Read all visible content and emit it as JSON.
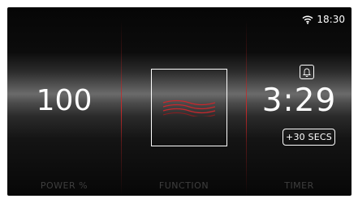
{
  "status_bar": {
    "wifi_icon": "wifi-icon",
    "time": "18:30"
  },
  "power": {
    "value": "100",
    "label": "POWER %"
  },
  "function": {
    "icon": "grill-waves-icon",
    "label": "FUNCTION"
  },
  "timer": {
    "bell_icon": "bell-icon",
    "value": "3:29",
    "add_button_label": "+30 SECS",
    "label": "TIMER"
  },
  "colors": {
    "accent_red": "#c8282d",
    "text": "#ffffff",
    "label_muted": "#3e3e3e"
  }
}
